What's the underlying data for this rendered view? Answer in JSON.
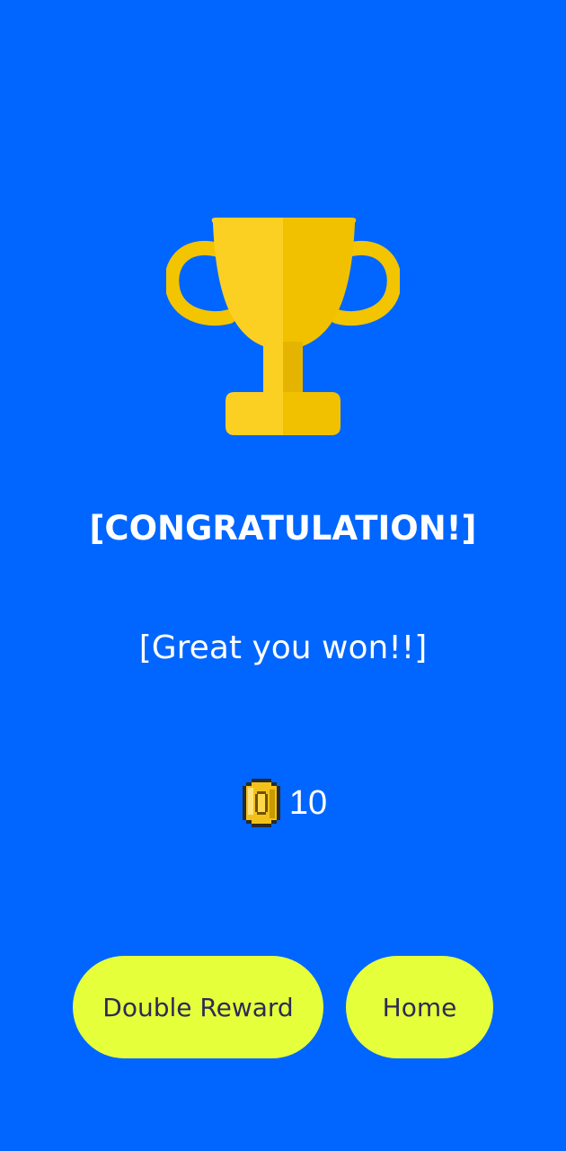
{
  "screen": {
    "background_color": "#0066FF",
    "title": "[CONGRATULATION!]",
    "message": "[Great you won!!]"
  },
  "reward": {
    "icon": "coin-icon",
    "amount": "10"
  },
  "buttons": {
    "double_reward_label": "Double Reward",
    "home_label": "Home",
    "button_color": "#E6FF3B",
    "button_text_color": "#2B2B55"
  },
  "trophy": {
    "icon": "trophy-icon",
    "color": "#FCD023"
  }
}
